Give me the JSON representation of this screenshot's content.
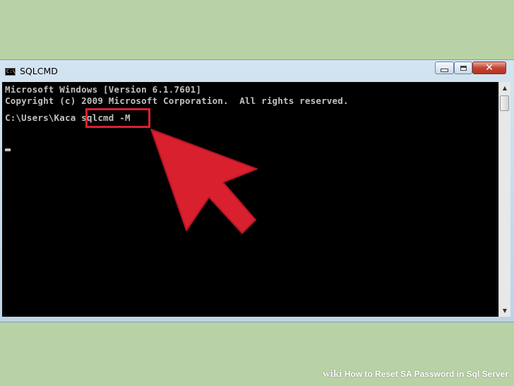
{
  "window": {
    "title": "SQLCMD",
    "icon_label": "C:\\",
    "controls": {
      "minimize": "minimize",
      "maximize": "maximize",
      "close": "✕"
    }
  },
  "console": {
    "lines": [
      "Microsoft Windows [Version 6.1.7601]",
      "Copyright (c) 2009 Microsoft Corporation.  All rights reserved.",
      "",
      "C:\\Users\\Kaca sqlcmd -M"
    ]
  },
  "annotation": {
    "highlighted_text": "sqlcmd -M",
    "color": "#d9202f"
  },
  "watermark": {
    "brand": "wiki",
    "text": "How to Reset SA Password in Sql Server"
  },
  "colors": {
    "background": "#b9d2a5",
    "console_bg": "#000000",
    "console_text": "#c0c0c0",
    "close_button": "#c44433"
  },
  "icons": [
    "console-app-icon",
    "minimize-icon",
    "maximize-icon",
    "close-icon",
    "scroll-up-icon",
    "scroll-down-icon",
    "arrow-pointer-icon"
  ]
}
